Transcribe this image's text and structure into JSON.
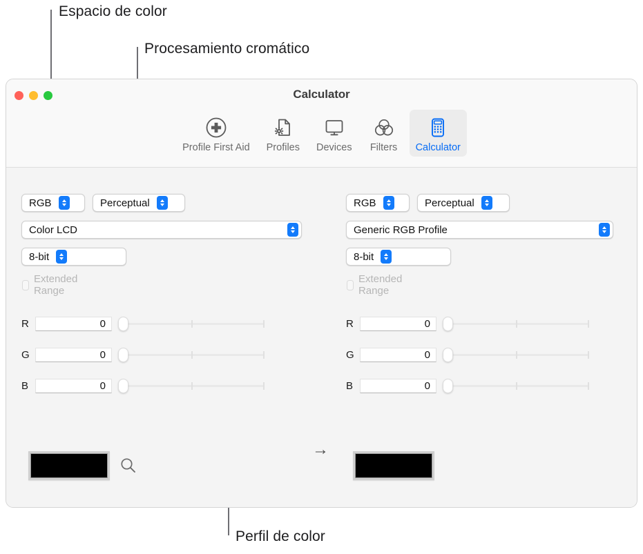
{
  "annotations": [
    {
      "id": "espacio",
      "label": "Espacio de color"
    },
    {
      "id": "procesamiento",
      "label": "Procesamiento cromático"
    },
    {
      "id": "perfil",
      "label": "Perfil de color"
    }
  ],
  "window": {
    "title": "Calculator",
    "traffic_lights": {
      "close": "close-button",
      "minimize": "minimize-button",
      "maximize": "maximize-button"
    }
  },
  "toolbar": {
    "items": [
      {
        "label": "Profile First Aid",
        "icon": "profile-first-aid-icon",
        "selected": false
      },
      {
        "label": "Profiles",
        "icon": "profiles-icon",
        "selected": false
      },
      {
        "label": "Devices",
        "icon": "devices-icon",
        "selected": false
      },
      {
        "label": "Filters",
        "icon": "filters-icon",
        "selected": false
      },
      {
        "label": "Calculator",
        "icon": "calculator-icon",
        "selected": true
      }
    ],
    "selected_color": "#066cf6"
  },
  "source_panel": {
    "color_space": "RGB",
    "rendering_intent": "Perceptual",
    "profile": "Color LCD",
    "bit_depth": "8-bit",
    "extended_range_label": "Extended Range",
    "extended_range_checked": false,
    "channels": [
      {
        "name": "R",
        "value": "0",
        "slider_pos": 0
      },
      {
        "name": "G",
        "value": "0",
        "slider_pos": 0
      },
      {
        "name": "B",
        "value": "0",
        "slider_pos": 0
      }
    ],
    "swatch_color": "#000000",
    "magnifier_icon": "magnifier-icon"
  },
  "target_panel": {
    "color_space": "RGB",
    "rendering_intent": "Perceptual",
    "profile": "Generic RGB Profile",
    "bit_depth": "8-bit",
    "extended_range_label": "Extended Range",
    "extended_range_checked": false,
    "channels": [
      {
        "name": "R",
        "value": "0",
        "slider_pos": 0
      },
      {
        "name": "G",
        "value": "0",
        "slider_pos": 0
      },
      {
        "name": "B",
        "value": "0",
        "slider_pos": 0
      }
    ],
    "swatch_color": "#000000"
  },
  "conversion_arrow": "→"
}
